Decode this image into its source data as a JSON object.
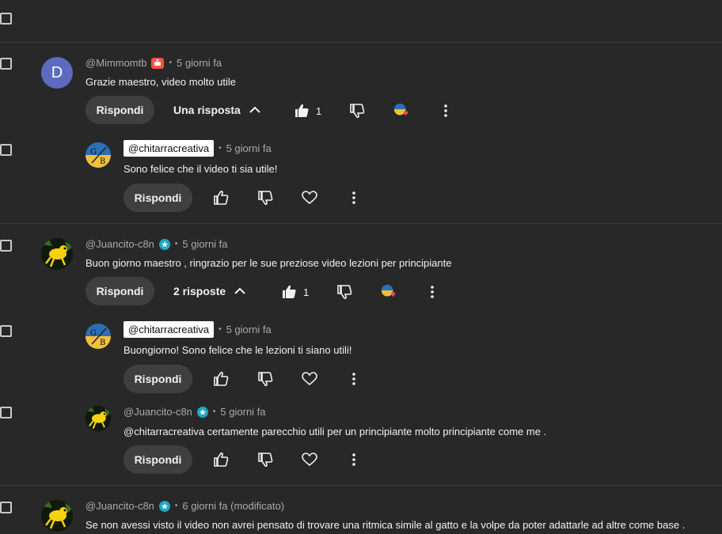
{
  "comments": [
    {
      "author": "@Mimmomtb",
      "avatar_letter": "D",
      "time": "5 giorni fa",
      "text": "Grazie maestro, video molto utile",
      "reply_label": "Rispondi",
      "replies_label": "Una risposta",
      "likes": "1"
    },
    {
      "author": "@chitarracreativa",
      "time": "5 giorni fa",
      "text": "Sono felice che il video ti sia utile!",
      "reply_label": "Rispondi"
    },
    {
      "author": "@Juancito-c8n",
      "time": "5 giorni fa",
      "text": "Buon giorno maestro , ringrazio per le sue preziose video lezioni per principiante",
      "reply_label": "Rispondi",
      "replies_label": "2 risposte",
      "likes": "1"
    },
    {
      "author": "@chitarracreativa",
      "time": "5 giorni fa",
      "text": "Buongiorno! Sono felice che le lezioni ti siano utili!",
      "reply_label": "Rispondi"
    },
    {
      "author": "@Juancito-c8n",
      "time": "5 giorni fa",
      "text": "@chitarracreativa certamente parecchio utili per un principiante molto principiante come me .",
      "reply_label": "Rispondi"
    },
    {
      "author": "@Juancito-c8n",
      "time": "6 giorni fa (modificato)",
      "text": "Se non avessi visto il video non avrei pensato di trovare una ritmica simile al gatto e la volpe da poter adattarle ad altre come base ."
    }
  ],
  "colors": {
    "background": "#282828",
    "button": "#3f3f3f",
    "meta_text": "#aaaaaa",
    "avatar_d": "#5c6bc0",
    "heart": "#ff4e45"
  }
}
